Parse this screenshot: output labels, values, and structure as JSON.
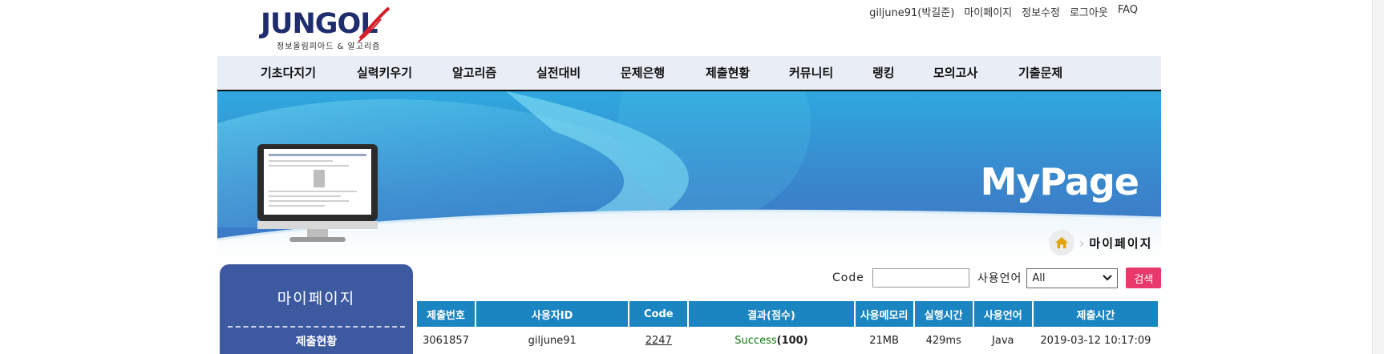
{
  "logo": {
    "word": "JUNGOL",
    "subtitle": "정보올림피아드 & 알고리즘"
  },
  "util_links": [
    "giljune91(박길준)",
    "마이페이지",
    "정보수정",
    "로그아웃",
    "FAQ"
  ],
  "nav": {
    "items": [
      "기초다지기",
      "실력키우기",
      "알고리즘",
      "실전대비",
      "문제은행",
      "제출현황",
      "커뮤니티",
      "랭킹",
      "모의고사",
      "기출문제"
    ]
  },
  "banner": {
    "title": "MyPage"
  },
  "breadcrumb": {
    "label": "마이페이지"
  },
  "sidebar": {
    "title": "마이페이지",
    "items": [
      "제출현황"
    ]
  },
  "search": {
    "code_label": "Code",
    "code_value": "",
    "lang_label": "사용언어",
    "lang_selected": "All",
    "button_label": "검색"
  },
  "table": {
    "headers": [
      "제출번호",
      "사용자ID",
      "Code",
      "결과(점수)",
      "사용메모리",
      "실행시간",
      "사용언어",
      "제출시간"
    ],
    "rows": [
      {
        "submission_no": "3061857",
        "user_id": "giljune91",
        "code": "2247",
        "result": "Success",
        "score": "(100)",
        "memory": "21MB",
        "time": "429ms",
        "language": "Java",
        "submitted_at": "2019-03-12 10:17:09"
      }
    ]
  },
  "colors": {
    "nav_bg": "#e9eef6",
    "header_blue": "#1a85c0",
    "sidebar_blue": "#3d5aa0",
    "search_button": "#e8396a",
    "success": "#0c7a0c",
    "metric_red": "#e02020"
  },
  "icons": [
    "home-icon",
    "chevron-right-icon",
    "chevron-down-icon"
  ]
}
